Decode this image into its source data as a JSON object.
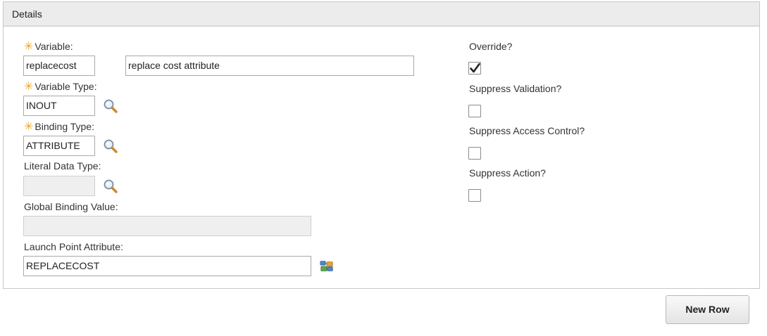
{
  "section": {
    "title": "Details"
  },
  "fields": {
    "variable": {
      "label": "Variable:",
      "value": "replacecost",
      "description": "replace cost attribute",
      "required": true
    },
    "variable_type": {
      "label": "Variable Type:",
      "value": "INOUT",
      "required": true
    },
    "binding_type": {
      "label": "Binding Type:",
      "value": "ATTRIBUTE",
      "required": true
    },
    "literal_data_type": {
      "label": "Literal Data Type:",
      "value": ""
    },
    "global_binding_value": {
      "label": "Global Binding Value:",
      "value": ""
    },
    "launch_point_attribute": {
      "label": "Launch Point Attribute:",
      "value": "REPLACECOST"
    }
  },
  "options": {
    "override": {
      "label": "Override?",
      "checked": true
    },
    "suppress_validation": {
      "label": "Suppress Validation?",
      "checked": false
    },
    "suppress_access_control": {
      "label": "Suppress Access Control?",
      "checked": false
    },
    "suppress_action": {
      "label": "Suppress Action?",
      "checked": false
    }
  },
  "icons": {
    "required": "asterisk-icon",
    "lookup": "magnifier-icon",
    "attribute_picker": "attribute-tree-icon",
    "check": "checkmark-icon"
  },
  "colors": {
    "required": "#f5a623",
    "header_bg": "#ececec"
  },
  "footer": {
    "new_row_label": "New Row"
  }
}
